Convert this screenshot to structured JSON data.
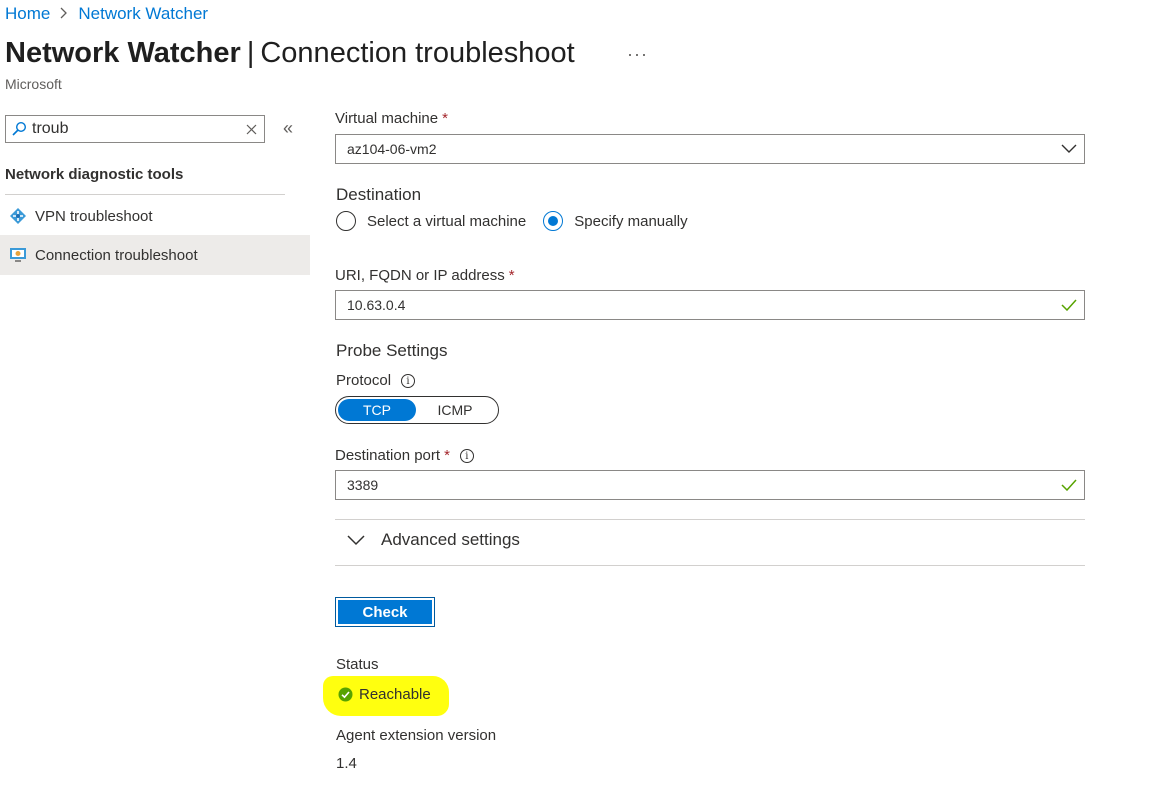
{
  "breadcrumb": {
    "home": "Home",
    "separator": ">",
    "current": "Network Watcher"
  },
  "header": {
    "service": "Network Watcher",
    "separator": "|",
    "blade": "Connection troubleshoot",
    "more": "···",
    "publisher": "Microsoft"
  },
  "sidebar": {
    "search_value": "troub",
    "collapse": "«",
    "group_title": "Network diagnostic tools",
    "items": [
      {
        "label": "VPN troubleshoot",
        "icon": "vpn-icon"
      },
      {
        "label": "Connection troubleshoot",
        "icon": "monitor-icon",
        "selected": true
      }
    ]
  },
  "form": {
    "vm_label": "Virtual machine",
    "required_mark": "*",
    "vm_value": "az104-06-vm2",
    "destination_title": "Destination",
    "dest_option_vm": "Select a virtual machine",
    "dest_option_manual": "Specify manually",
    "dest_selected": "manual",
    "address_label": "URI, FQDN or IP address",
    "address_value": "10.63.0.4",
    "probe_title": "Probe Settings",
    "protocol_label": "Protocol",
    "protocol_options": [
      "TCP",
      "ICMP"
    ],
    "protocol_selected": "TCP",
    "port_label": "Destination port",
    "port_value": "3389",
    "advanced_label": "Advanced settings",
    "check_button": "Check",
    "info_glyph": "i"
  },
  "result": {
    "status_label": "Status",
    "status_value": "Reachable",
    "agent_label": "Agent extension version",
    "agent_value": "1.4"
  },
  "colors": {
    "accent": "#0078d4",
    "success": "#57a300",
    "required": "#a4262c",
    "highlight": "#ffff0f"
  }
}
